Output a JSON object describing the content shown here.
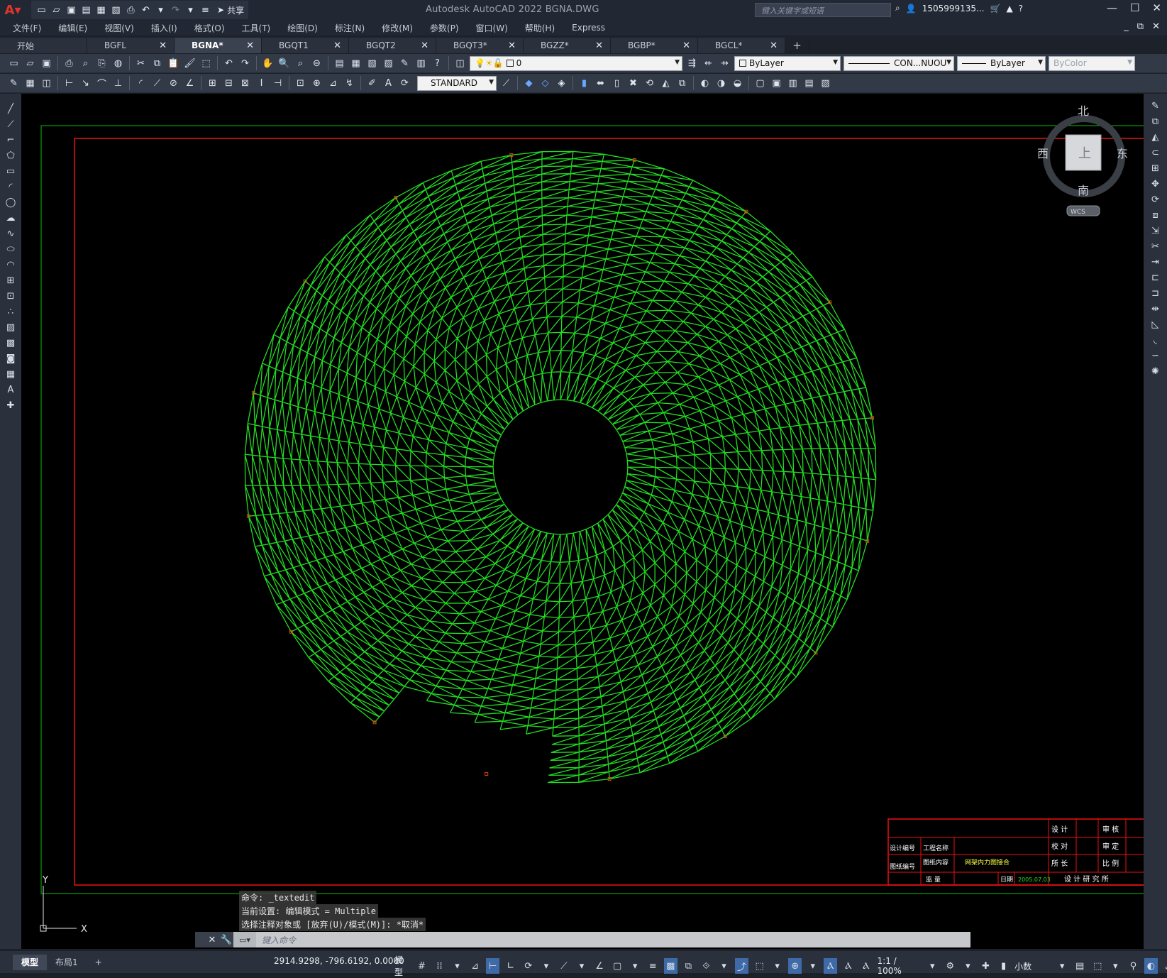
{
  "app": {
    "title": "Autodesk AutoCAD 2022    BGNA.DWG",
    "share_label": "共享",
    "search_placeholder": "键入关键字或短语",
    "user": "1505999135...",
    "menu": [
      "文件(F)",
      "编辑(E)",
      "视图(V)",
      "插入(I)",
      "格式(O)",
      "工具(T)",
      "绘图(D)",
      "标注(N)",
      "修改(M)",
      "参数(P)",
      "窗口(W)",
      "帮助(H)",
      "Express"
    ]
  },
  "tabs": [
    {
      "label": "开始",
      "closable": false
    },
    {
      "label": "BGFL",
      "closable": true
    },
    {
      "label": "BGNA*",
      "closable": true,
      "active": true
    },
    {
      "label": "BGQT1",
      "closable": true
    },
    {
      "label": "BGQT2",
      "closable": true
    },
    {
      "label": "BGQT3*",
      "closable": true
    },
    {
      "label": "BGZZ*",
      "closable": true
    },
    {
      "label": "BGBP*",
      "closable": true
    },
    {
      "label": "BGCL*",
      "closable": true
    }
  ],
  "properties": {
    "layer": "0",
    "color": "ByLayer",
    "linetype": "CON...NUOU",
    "lineweight": "ByLayer",
    "plotstyle": "ByColor",
    "text_style": "STANDARD"
  },
  "viewcube": {
    "north": "北",
    "south": "南",
    "east": "东",
    "west": "西",
    "face": "上",
    "wcs": "WCS"
  },
  "ucs": {
    "x": "X",
    "y": "Y"
  },
  "title_block": {
    "design": "设 计",
    "check": "校 对",
    "director": "所 长",
    "review": "审 核",
    "approve": "审 定",
    "scale": "比 例",
    "design_no": "设计编号",
    "project_name": "工程名称",
    "drawing_no": "图纸编号",
    "drawing_content": "图纸内容",
    "drawing_title": "网架内力图接合",
    "quality": "监  量",
    "date_label": "日期",
    "date": "2005.07.03",
    "institute": "设  计  研  究  所"
  },
  "command": {
    "history": [
      "命令: _textedit",
      "当前设置: 编辑模式 = Multiple",
      "选择注释对象或 [放弃(U)/模式(M)]: *取消*"
    ],
    "prompt": "键入命令"
  },
  "status": {
    "layouts": [
      "模型",
      "布局1"
    ],
    "coords": "2914.9298, -796.6192, 0.0000",
    "space": "模型",
    "scale": "1:1 / 100%",
    "units": "小数"
  },
  "colors": {
    "drawing_green": "#22dd22",
    "frame_red": "#ee1111",
    "outer_frame_green": "#11bb11",
    "canvas_black": "#000000"
  }
}
